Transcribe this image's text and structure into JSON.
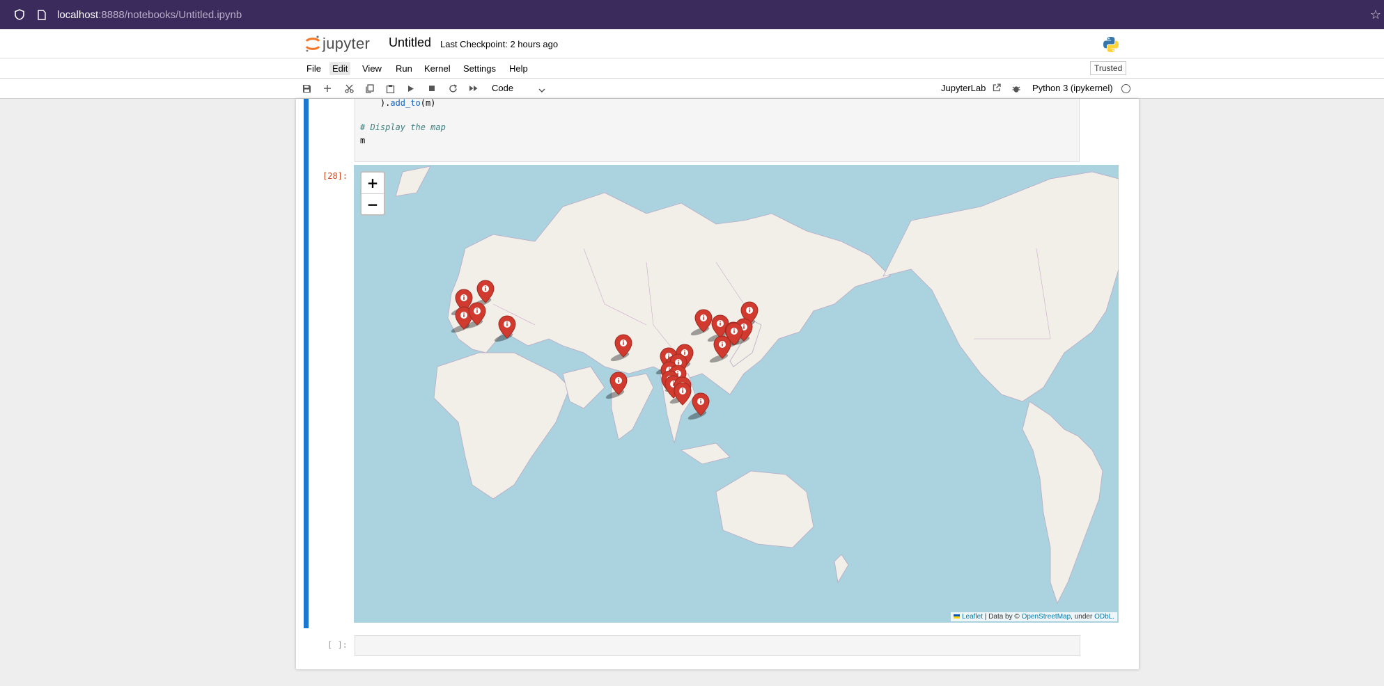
{
  "browser": {
    "url_host": "localhost",
    "url_rest": ":8888/notebooks/Untitled.ipynb"
  },
  "header": {
    "logo_text": "jupyter",
    "notebook_title": "Untitled",
    "checkpoint": "Last Checkpoint: 2 hours ago"
  },
  "menu": {
    "items": [
      "File",
      "Edit",
      "View",
      "Run",
      "Kernel",
      "Settings",
      "Help"
    ],
    "active": "Edit",
    "trusted": "Trusted"
  },
  "toolbar": {
    "cell_type": "Code",
    "jupyterlab": "JupyterLab",
    "kernel": "Python 3 (ipykernel)"
  },
  "cells": {
    "code_lines": [
      "    ).add_to(m)",
      "",
      "# Display the map",
      "m"
    ],
    "output_prompt": "[28]:",
    "empty_prompt": "[ ]:"
  },
  "map": {
    "zoom_in": "+",
    "zoom_out": "−",
    "attribution": {
      "leaflet": "Leaflet",
      "data_by": "| Data by ©",
      "osm": "OpenStreetMap",
      "under": ", under",
      "odbl": "ODbL."
    },
    "marker_color": "#d03a2f",
    "marker_icon": "info-sign",
    "marker_count": 25
  },
  "colors": {
    "browser_bar": "#3b2a5c",
    "cell_selected": "#1976d2",
    "water": "#aad3df",
    "land": "#f2efe9"
  }
}
